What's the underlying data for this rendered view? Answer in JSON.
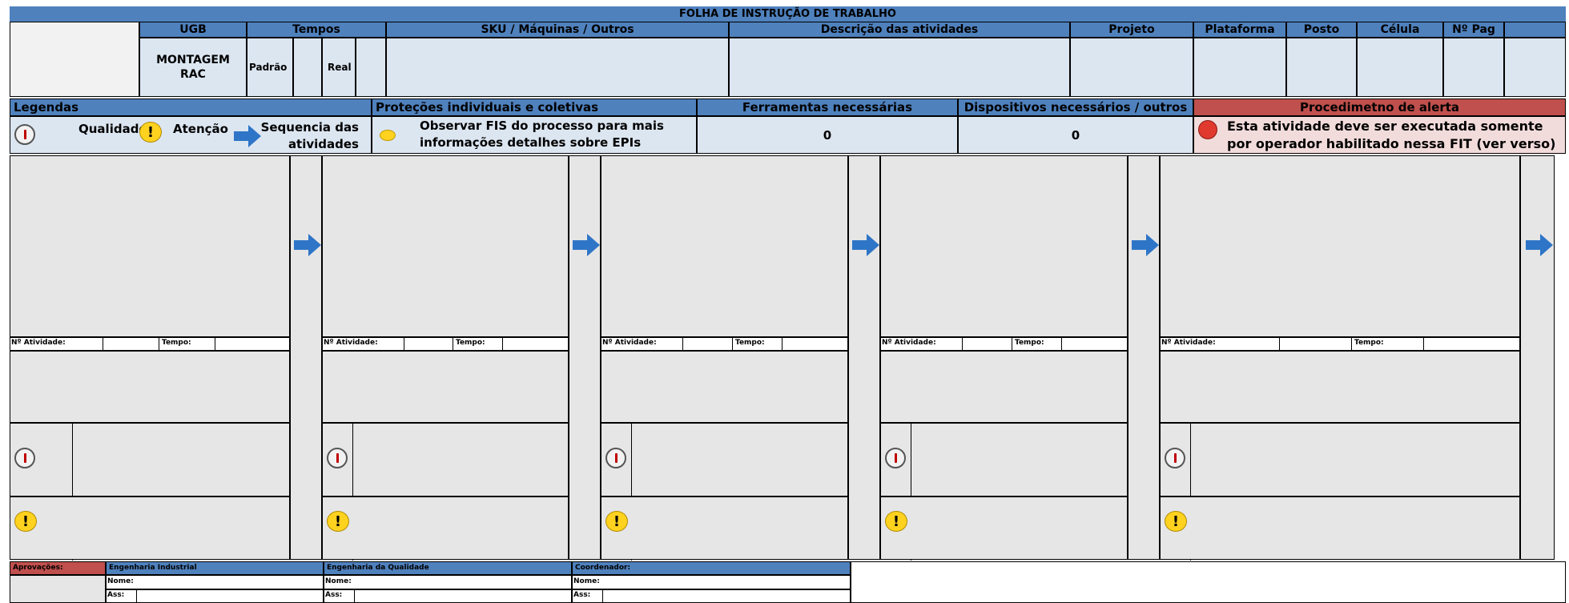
{
  "header": {
    "title": "FOLHA DE INSTRUÇÃO DE TRABALHO",
    "columns": {
      "ugb": "UGB",
      "tempos": "Tempos",
      "sku": "SKU / Máquinas / Outros",
      "descricao": "Descrição das atividades",
      "projeto": "Projeto",
      "plataforma": "Plataforma",
      "posto": "Posto",
      "celula": "Célula",
      "npag": "Nº Pag"
    },
    "ugb_value": "MONTAGEM RAC",
    "padrao": "Padrão",
    "real": "Real"
  },
  "legend": {
    "title": "Legendas",
    "quality": "Qualidade",
    "attention": "Atenção",
    "sequence": "Sequencia das atividades"
  },
  "protections": {
    "title": "Proteções individuais e coletivas",
    "text": "Observar FIS do processo para mais informações detalhes sobre EPIs"
  },
  "tools": {
    "title": "Ferramentas necessárias",
    "value": "0"
  },
  "devices": {
    "title": "Dispositivos necessários / outros",
    "value": "0"
  },
  "alert": {
    "title": "Procedimetno de alerta",
    "text_line1": "Esta atividade deve ser executada somente",
    "text_line2": "por operador habilitado nessa FIT (ver verso)"
  },
  "steps": {
    "activity_label": "Nº Atividade:",
    "time_label": "Tempo:",
    "count": 5
  },
  "footer": {
    "approval": "Aprovações:",
    "eng_ind": "Engenharia Industrial",
    "eng_qual": "Engenharia da Qualidade",
    "coord": "Coordenador:",
    "name": "Nome:",
    "ass": "Ass:"
  },
  "colors": {
    "header_blue": "#4f81bd",
    "cell_light": "#dce6f1",
    "alert_red": "#c0504d",
    "alert_pink": "#f2dcdb",
    "arrow_blue": "#2e75c7"
  }
}
